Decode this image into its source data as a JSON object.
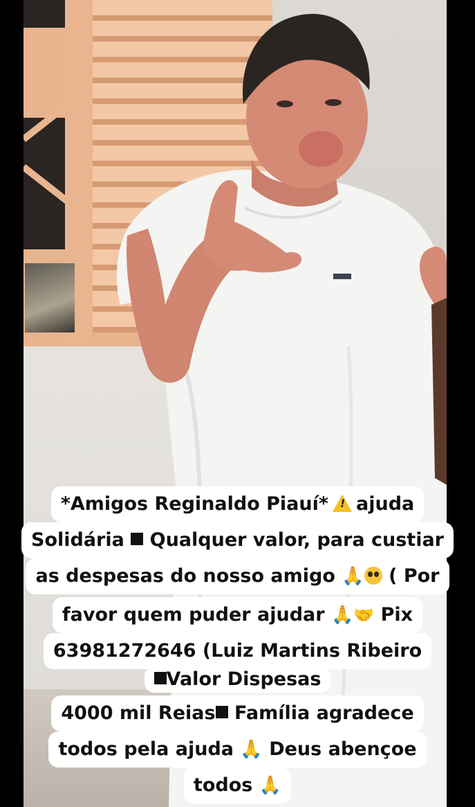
{
  "post": {
    "caption_lines": [
      {
        "id": "l1",
        "parts": [
          "*Amigos Reginaldo Piauí*",
          "warning-icon",
          "ajuda"
        ]
      },
      {
        "id": "l2",
        "parts": [
          "Solidária",
          "black-square",
          "Qualquer valor, para custiar"
        ]
      },
      {
        "id": "l3",
        "parts": [
          "as despesas do nosso amigo",
          "pray-icon",
          "pleading-face-icon",
          "( Por"
        ]
      },
      {
        "id": "l4",
        "parts": [
          "favor quem puder ajudar",
          "pray-icon",
          "handshake-icon",
          "Pix"
        ]
      },
      {
        "id": "l5",
        "parts": [
          "63981272646 (Luiz Martins Ribeiro"
        ]
      },
      {
        "id": "l6",
        "parts": [
          "black-square",
          "Valor Dispesas"
        ]
      },
      {
        "id": "l7",
        "parts": [
          "4000 mil Reias",
          "black-square",
          "Família agradece"
        ]
      },
      {
        "id": "l8",
        "parts": [
          "todos pela ajuda",
          "pray-icon",
          "Deus abençoe"
        ]
      },
      {
        "id": "l9",
        "parts": [
          "todos",
          "pray-icon"
        ]
      }
    ],
    "text": {
      "l1a": "*Amigos Reginaldo Piauí*",
      "l1b": "ajuda",
      "l2a": "Solidária",
      "l2b": "Qualquer valor, para custiar",
      "l3a": "as despesas do nosso amigo",
      "l3b": "( Por",
      "l4a": "favor quem puder ajudar",
      "l4b": "Pix",
      "l5a": "63981272646 (Luiz Martins Ribeiro",
      "l6a": "Valor Dispesas",
      "l7a": "4000 mil Reias",
      "l7b": "Família agradece",
      "l8a": "todos pela ajuda",
      "l8b": "Deus abençoe",
      "l9a": "todos"
    }
  },
  "colors": {
    "caption_bg": "#ffffff",
    "caption_text": "#111111",
    "shirt": "#f4f4f2",
    "skin": "#d58a76",
    "hair": "#2b2522",
    "background_bars": "#000000"
  }
}
